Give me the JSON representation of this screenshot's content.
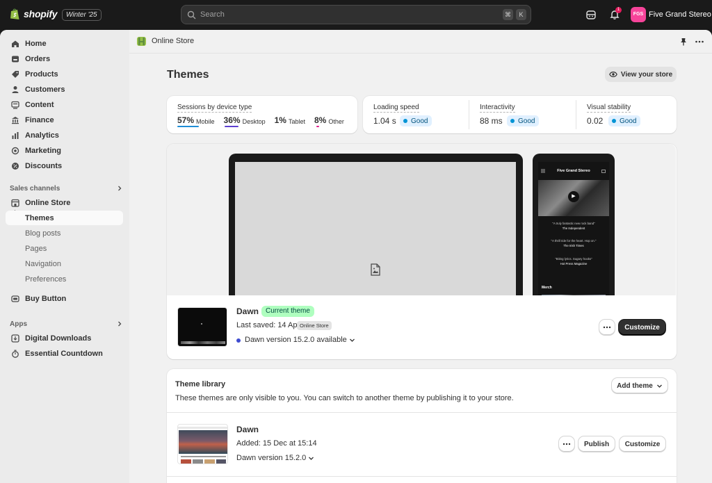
{
  "topbar": {
    "brand": "shopify",
    "edition": "Winter '25",
    "search_placeholder": "Search",
    "kbd_cmd": "⌘",
    "kbd_k": "K",
    "notification_count": "1",
    "store_initials": "FGS",
    "store_name": "Five Grand Stereo"
  },
  "sidebar": {
    "main": [
      {
        "label": "Home",
        "icon": "home-icon"
      },
      {
        "label": "Orders",
        "icon": "orders-icon"
      },
      {
        "label": "Products",
        "icon": "tag-icon"
      },
      {
        "label": "Customers",
        "icon": "person-icon"
      },
      {
        "label": "Content",
        "icon": "content-icon"
      },
      {
        "label": "Finance",
        "icon": "bank-icon"
      },
      {
        "label": "Analytics",
        "icon": "chart-icon"
      },
      {
        "label": "Marketing",
        "icon": "target-icon"
      },
      {
        "label": "Discounts",
        "icon": "discount-icon"
      }
    ],
    "sales_channels_label": "Sales channels",
    "online_store_label": "Online Store",
    "online_store_sub": [
      "Themes",
      "Blog posts",
      "Pages",
      "Navigation",
      "Preferences"
    ],
    "buy_button_label": "Buy Button",
    "apps_label": "Apps",
    "apps": [
      "Digital Downloads",
      "Essential Countdown"
    ]
  },
  "breadcrumb": {
    "label": "Online Store"
  },
  "page": {
    "title": "Themes",
    "view_store": "View your store"
  },
  "sessions": {
    "label": "Sessions by device type",
    "items": [
      {
        "pct": "57%",
        "label": "Mobile",
        "color": "#1f8dd6",
        "share": 0.57
      },
      {
        "pct": "36%",
        "label": "Desktop",
        "color": "#5c3fd0",
        "share": 0.36
      },
      {
        "pct": "1%",
        "label": "Tablet",
        "color": "#ffffff",
        "share": 0.01
      },
      {
        "pct": "8%",
        "label": "Other",
        "color": "#e01e8b",
        "share": 0.08
      }
    ]
  },
  "metrics": [
    {
      "label": "Loading speed",
      "value": "1.04 s",
      "status": "Good"
    },
    {
      "label": "Interactivity",
      "value": "88 ms",
      "status": "Good"
    },
    {
      "label": "Visual stability",
      "value": "0.02",
      "status": "Good"
    }
  ],
  "preview": {
    "phone_store_title": "Five Grand Stereo",
    "quotes": [
      {
        "text": "\"A truly fantastic new rock band\"",
        "source": "The Independent"
      },
      {
        "text": "\"A thrill ride for the heart. Hop on.\"",
        "source": "The Irish Times"
      },
      {
        "text": "\"Biting lyrics. Sugary hooks\"",
        "source": "Hot Press Magazine"
      }
    ],
    "merch_label": "Merch"
  },
  "current_theme": {
    "name": "Dawn",
    "badge": "Current theme",
    "last_saved": "Last saved: 14 Apr",
    "tooltip": "Online Store",
    "version": "Dawn version 15.2.0 available",
    "customize": "Customize"
  },
  "library": {
    "title": "Theme library",
    "subtitle": "These themes are only visible to you. You can switch to another theme by publishing it to your store.",
    "add_theme": "Add theme",
    "themes": [
      {
        "name": "Dawn",
        "added": "Added: 15 Dec at 15:14",
        "version": "Dawn version 15.2.0",
        "publish": "Publish",
        "customize": "Customize"
      }
    ]
  }
}
